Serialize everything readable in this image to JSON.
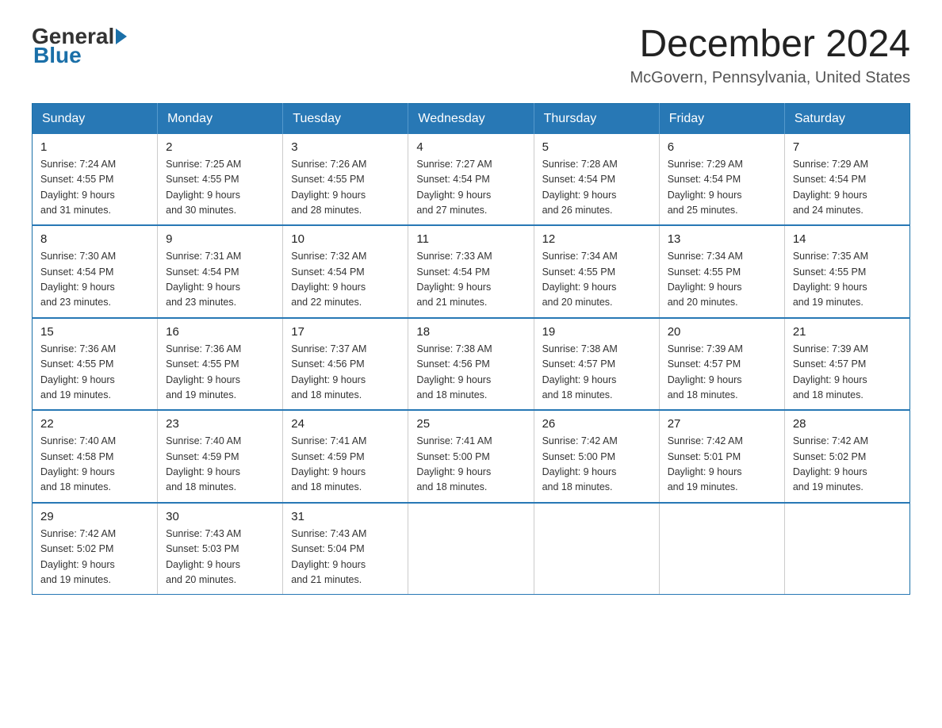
{
  "logo": {
    "text_general": "General",
    "text_blue": "Blue"
  },
  "title": {
    "month_year": "December 2024",
    "location": "McGovern, Pennsylvania, United States"
  },
  "weekdays": [
    "Sunday",
    "Monday",
    "Tuesday",
    "Wednesday",
    "Thursday",
    "Friday",
    "Saturday"
  ],
  "weeks": [
    [
      {
        "day": "1",
        "sunrise": "7:24 AM",
        "sunset": "4:55 PM",
        "daylight": "9 hours and 31 minutes."
      },
      {
        "day": "2",
        "sunrise": "7:25 AM",
        "sunset": "4:55 PM",
        "daylight": "9 hours and 30 minutes."
      },
      {
        "day": "3",
        "sunrise": "7:26 AM",
        "sunset": "4:55 PM",
        "daylight": "9 hours and 28 minutes."
      },
      {
        "day": "4",
        "sunrise": "7:27 AM",
        "sunset": "4:54 PM",
        "daylight": "9 hours and 27 minutes."
      },
      {
        "day": "5",
        "sunrise": "7:28 AM",
        "sunset": "4:54 PM",
        "daylight": "9 hours and 26 minutes."
      },
      {
        "day": "6",
        "sunrise": "7:29 AM",
        "sunset": "4:54 PM",
        "daylight": "9 hours and 25 minutes."
      },
      {
        "day": "7",
        "sunrise": "7:29 AM",
        "sunset": "4:54 PM",
        "daylight": "9 hours and 24 minutes."
      }
    ],
    [
      {
        "day": "8",
        "sunrise": "7:30 AM",
        "sunset": "4:54 PM",
        "daylight": "9 hours and 23 minutes."
      },
      {
        "day": "9",
        "sunrise": "7:31 AM",
        "sunset": "4:54 PM",
        "daylight": "9 hours and 23 minutes."
      },
      {
        "day": "10",
        "sunrise": "7:32 AM",
        "sunset": "4:54 PM",
        "daylight": "9 hours and 22 minutes."
      },
      {
        "day": "11",
        "sunrise": "7:33 AM",
        "sunset": "4:54 PM",
        "daylight": "9 hours and 21 minutes."
      },
      {
        "day": "12",
        "sunrise": "7:34 AM",
        "sunset": "4:55 PM",
        "daylight": "9 hours and 20 minutes."
      },
      {
        "day": "13",
        "sunrise": "7:34 AM",
        "sunset": "4:55 PM",
        "daylight": "9 hours and 20 minutes."
      },
      {
        "day": "14",
        "sunrise": "7:35 AM",
        "sunset": "4:55 PM",
        "daylight": "9 hours and 19 minutes."
      }
    ],
    [
      {
        "day": "15",
        "sunrise": "7:36 AM",
        "sunset": "4:55 PM",
        "daylight": "9 hours and 19 minutes."
      },
      {
        "day": "16",
        "sunrise": "7:36 AM",
        "sunset": "4:55 PM",
        "daylight": "9 hours and 19 minutes."
      },
      {
        "day": "17",
        "sunrise": "7:37 AM",
        "sunset": "4:56 PM",
        "daylight": "9 hours and 18 minutes."
      },
      {
        "day": "18",
        "sunrise": "7:38 AM",
        "sunset": "4:56 PM",
        "daylight": "9 hours and 18 minutes."
      },
      {
        "day": "19",
        "sunrise": "7:38 AM",
        "sunset": "4:57 PM",
        "daylight": "9 hours and 18 minutes."
      },
      {
        "day": "20",
        "sunrise": "7:39 AM",
        "sunset": "4:57 PM",
        "daylight": "9 hours and 18 minutes."
      },
      {
        "day": "21",
        "sunrise": "7:39 AM",
        "sunset": "4:57 PM",
        "daylight": "9 hours and 18 minutes."
      }
    ],
    [
      {
        "day": "22",
        "sunrise": "7:40 AM",
        "sunset": "4:58 PM",
        "daylight": "9 hours and 18 minutes."
      },
      {
        "day": "23",
        "sunrise": "7:40 AM",
        "sunset": "4:59 PM",
        "daylight": "9 hours and 18 minutes."
      },
      {
        "day": "24",
        "sunrise": "7:41 AM",
        "sunset": "4:59 PM",
        "daylight": "9 hours and 18 minutes."
      },
      {
        "day": "25",
        "sunrise": "7:41 AM",
        "sunset": "5:00 PM",
        "daylight": "9 hours and 18 minutes."
      },
      {
        "day": "26",
        "sunrise": "7:42 AM",
        "sunset": "5:00 PM",
        "daylight": "9 hours and 18 minutes."
      },
      {
        "day": "27",
        "sunrise": "7:42 AM",
        "sunset": "5:01 PM",
        "daylight": "9 hours and 19 minutes."
      },
      {
        "day": "28",
        "sunrise": "7:42 AM",
        "sunset": "5:02 PM",
        "daylight": "9 hours and 19 minutes."
      }
    ],
    [
      {
        "day": "29",
        "sunrise": "7:42 AM",
        "sunset": "5:02 PM",
        "daylight": "9 hours and 19 minutes."
      },
      {
        "day": "30",
        "sunrise": "7:43 AM",
        "sunset": "5:03 PM",
        "daylight": "9 hours and 20 minutes."
      },
      {
        "day": "31",
        "sunrise": "7:43 AM",
        "sunset": "5:04 PM",
        "daylight": "9 hours and 21 minutes."
      },
      null,
      null,
      null,
      null
    ]
  ],
  "labels": {
    "sunrise": "Sunrise:",
    "sunset": "Sunset:",
    "daylight": "Daylight:"
  }
}
